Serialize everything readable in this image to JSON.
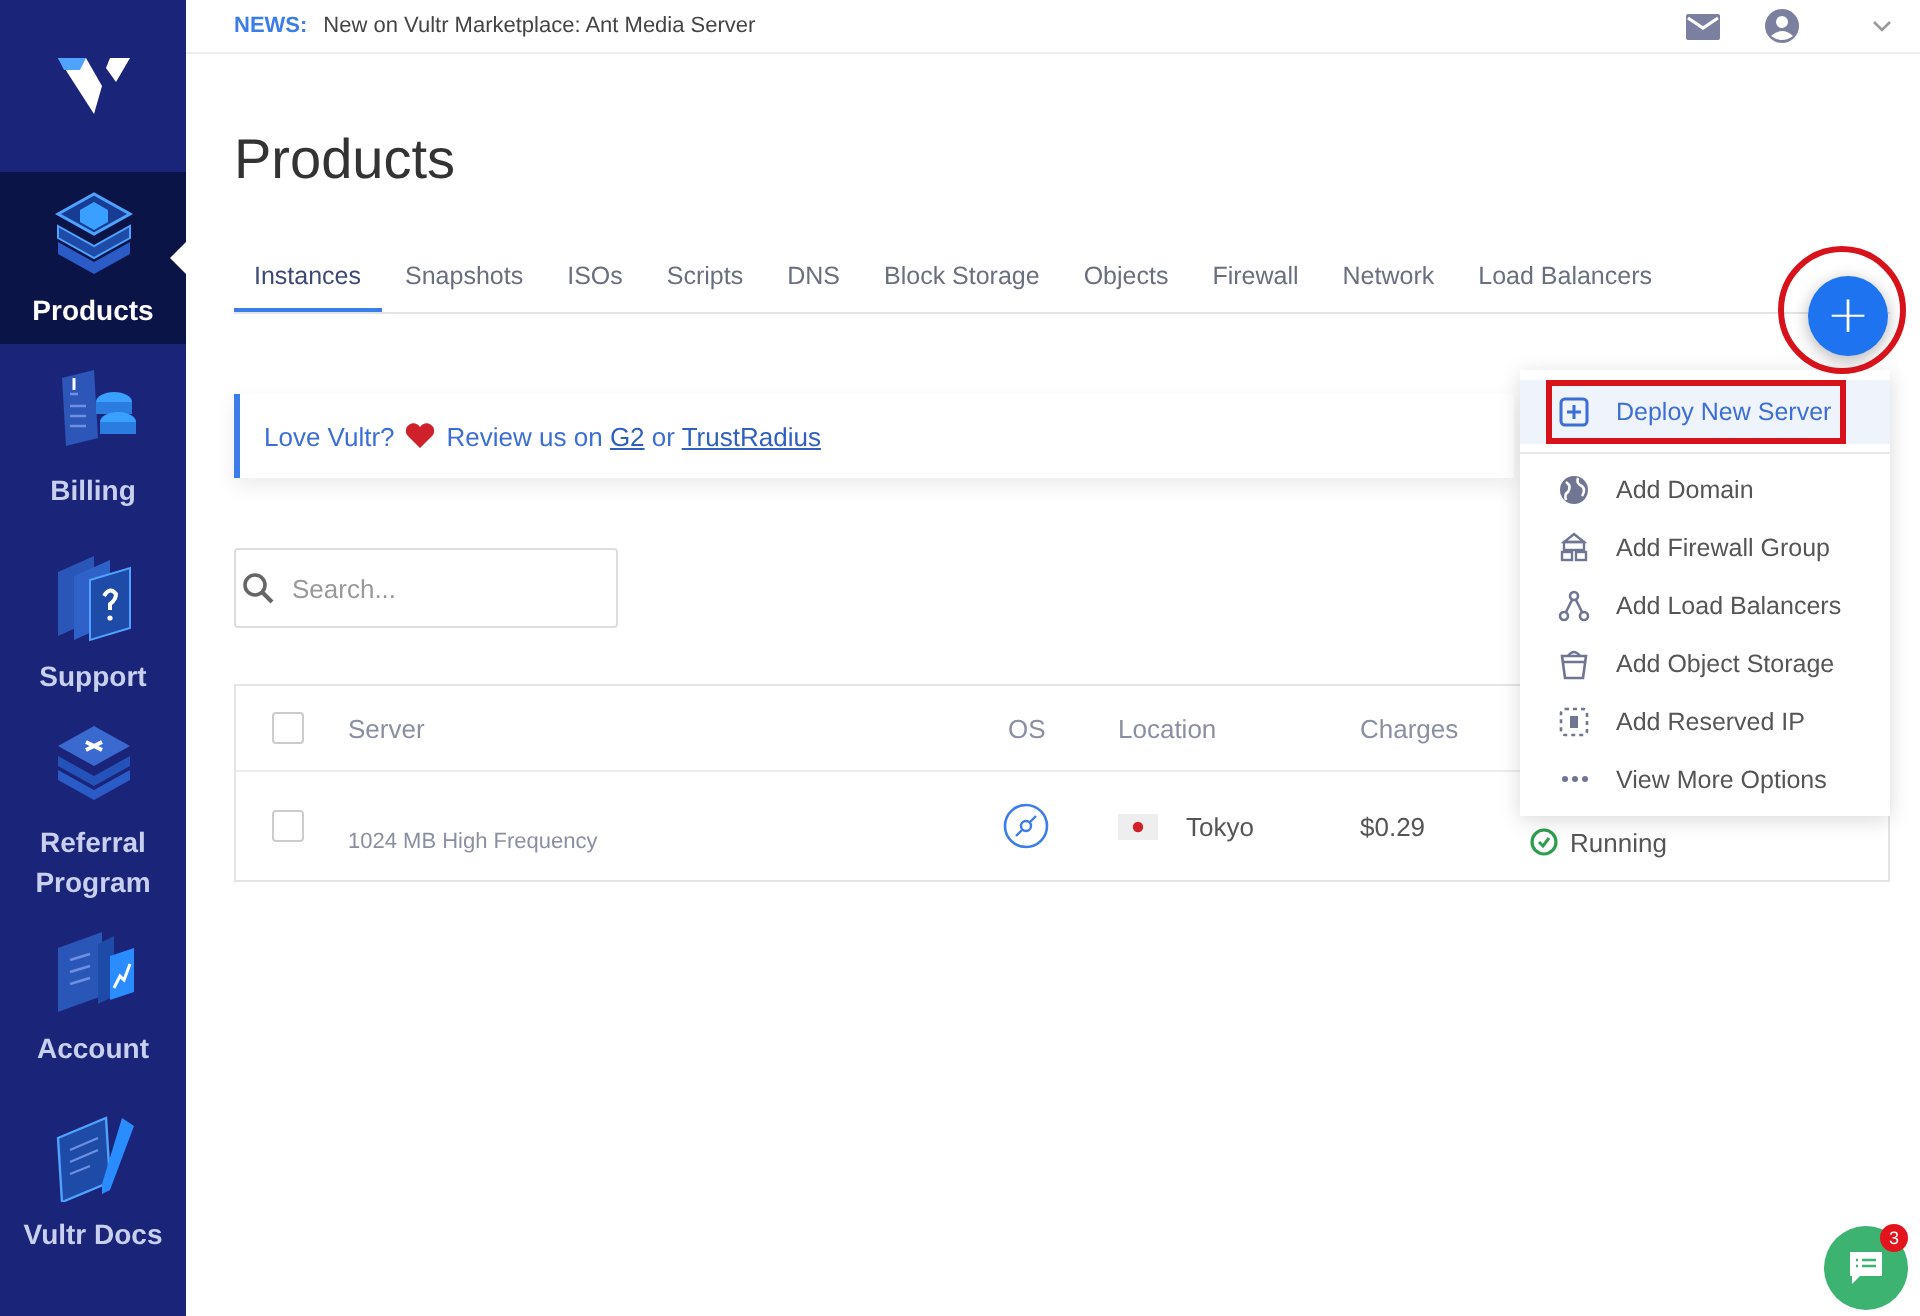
{
  "sidebar": {
    "items": [
      {
        "label": "Products",
        "selected": true
      },
      {
        "label": "Billing",
        "selected": false
      },
      {
        "label": "Support",
        "selected": false
      },
      {
        "label": "Referral Program",
        "selected": false
      },
      {
        "label": "Account",
        "selected": false
      },
      {
        "label": "Vultr Docs",
        "selected": false
      }
    ]
  },
  "topbar": {
    "news_label": "NEWS:",
    "news_text": "New on Vultr Marketplace: Ant Media Server"
  },
  "page": {
    "title": "Products"
  },
  "tabs": [
    {
      "label": "Instances",
      "selected": true
    },
    {
      "label": "Snapshots",
      "selected": false
    },
    {
      "label": "ISOs",
      "selected": false
    },
    {
      "label": "Scripts",
      "selected": false
    },
    {
      "label": "DNS",
      "selected": false
    },
    {
      "label": "Block Storage",
      "selected": false
    },
    {
      "label": "Objects",
      "selected": false
    },
    {
      "label": "Firewall",
      "selected": false
    },
    {
      "label": "Network",
      "selected": false
    },
    {
      "label": "Load Balancers",
      "selected": false
    }
  ],
  "banner": {
    "lead": "Love Vultr?",
    "text": "Review us on",
    "link_1": "G2",
    "joiner": "or",
    "link_2": "TrustRadius"
  },
  "search": {
    "placeholder": "Search..."
  },
  "table": {
    "select_all_checked": false,
    "columns": [
      "Server",
      "OS",
      "Location",
      "Charges"
    ],
    "rows": [
      {
        "checked": false,
        "server_detail": "1024 MB High Frequency",
        "location": "Tokyo",
        "charges": "$0.29",
        "status": "Running"
      }
    ]
  },
  "fab": {
    "label": "+",
    "highlighted": true
  },
  "menu": {
    "items": [
      {
        "label": "Deploy New Server",
        "selected": true,
        "highlighted": true
      },
      {
        "label": "Add Domain",
        "selected": false,
        "highlighted": false
      },
      {
        "label": "Add Firewall Group",
        "selected": false,
        "highlighted": false
      },
      {
        "label": "Add Load Balancers",
        "selected": false,
        "highlighted": false
      },
      {
        "label": "Add Object Storage",
        "selected": false,
        "highlighted": false
      },
      {
        "label": "Add Reserved IP",
        "selected": false,
        "highlighted": false
      },
      {
        "label": "View More Options",
        "selected": false,
        "highlighted": false
      }
    ]
  },
  "chat": {
    "badge": "3"
  }
}
